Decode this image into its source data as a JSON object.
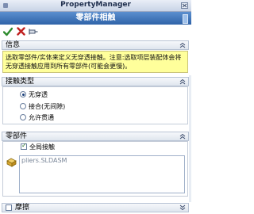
{
  "window": {
    "title": "PropertyManager"
  },
  "feature": {
    "title": "零部件相触"
  },
  "sections": {
    "info": {
      "header": "信息",
      "message": "选取零部件/实体来定义无穿透接触。注意:选取项层装配体会将无穿透接触应用到所有零部件(可能会更慢)。"
    },
    "contact_type": {
      "header": "接触类型",
      "options": [
        "无穿透",
        "接合(无间隙)",
        "允许贯通"
      ],
      "selected": "无穿透"
    },
    "components": {
      "header": "零部件",
      "global_contact_label": "全局接触",
      "global_contact_checked": true,
      "selection_items": [
        "pliers.SLDASM"
      ]
    },
    "friction": {
      "header": "摩擦",
      "checked": false
    }
  },
  "colors": {
    "banner": "#2f63a8",
    "info_background": "#ffff9b",
    "ok_green": "#2e8b2e",
    "cancel_red": "#c02020"
  },
  "icons": {
    "ok": "check-icon",
    "cancel": "close-icon",
    "pin": "pushpin-icon",
    "collapse": "chevron-up-icon",
    "components": "component-icon"
  }
}
